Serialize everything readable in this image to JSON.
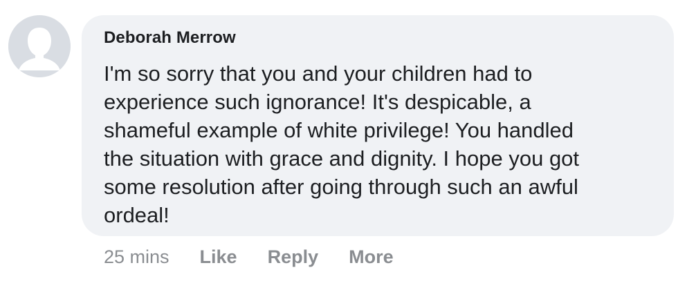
{
  "comment": {
    "author": "Deborah Merrow",
    "text": "I'm so sorry that you and your children had to\nexperience such ignorance! It's despicable, a\nshameful example of white privilege! You handled\nthe situation with grace and dignity. I hope you got\nsome resolution after going through such an awful\nordeal!",
    "timestamp": "25 mins",
    "actions": {
      "like": "Like",
      "reply": "Reply",
      "more": "More"
    }
  },
  "colors": {
    "bubble_background": "#f0f2f5",
    "text": "#1c1e21",
    "meta_text": "#8a8d91",
    "avatar_background": "#d9dde3",
    "avatar_silhouette": "#ffffff"
  },
  "icons": {
    "avatar": "default-profile-silhouette-icon"
  }
}
